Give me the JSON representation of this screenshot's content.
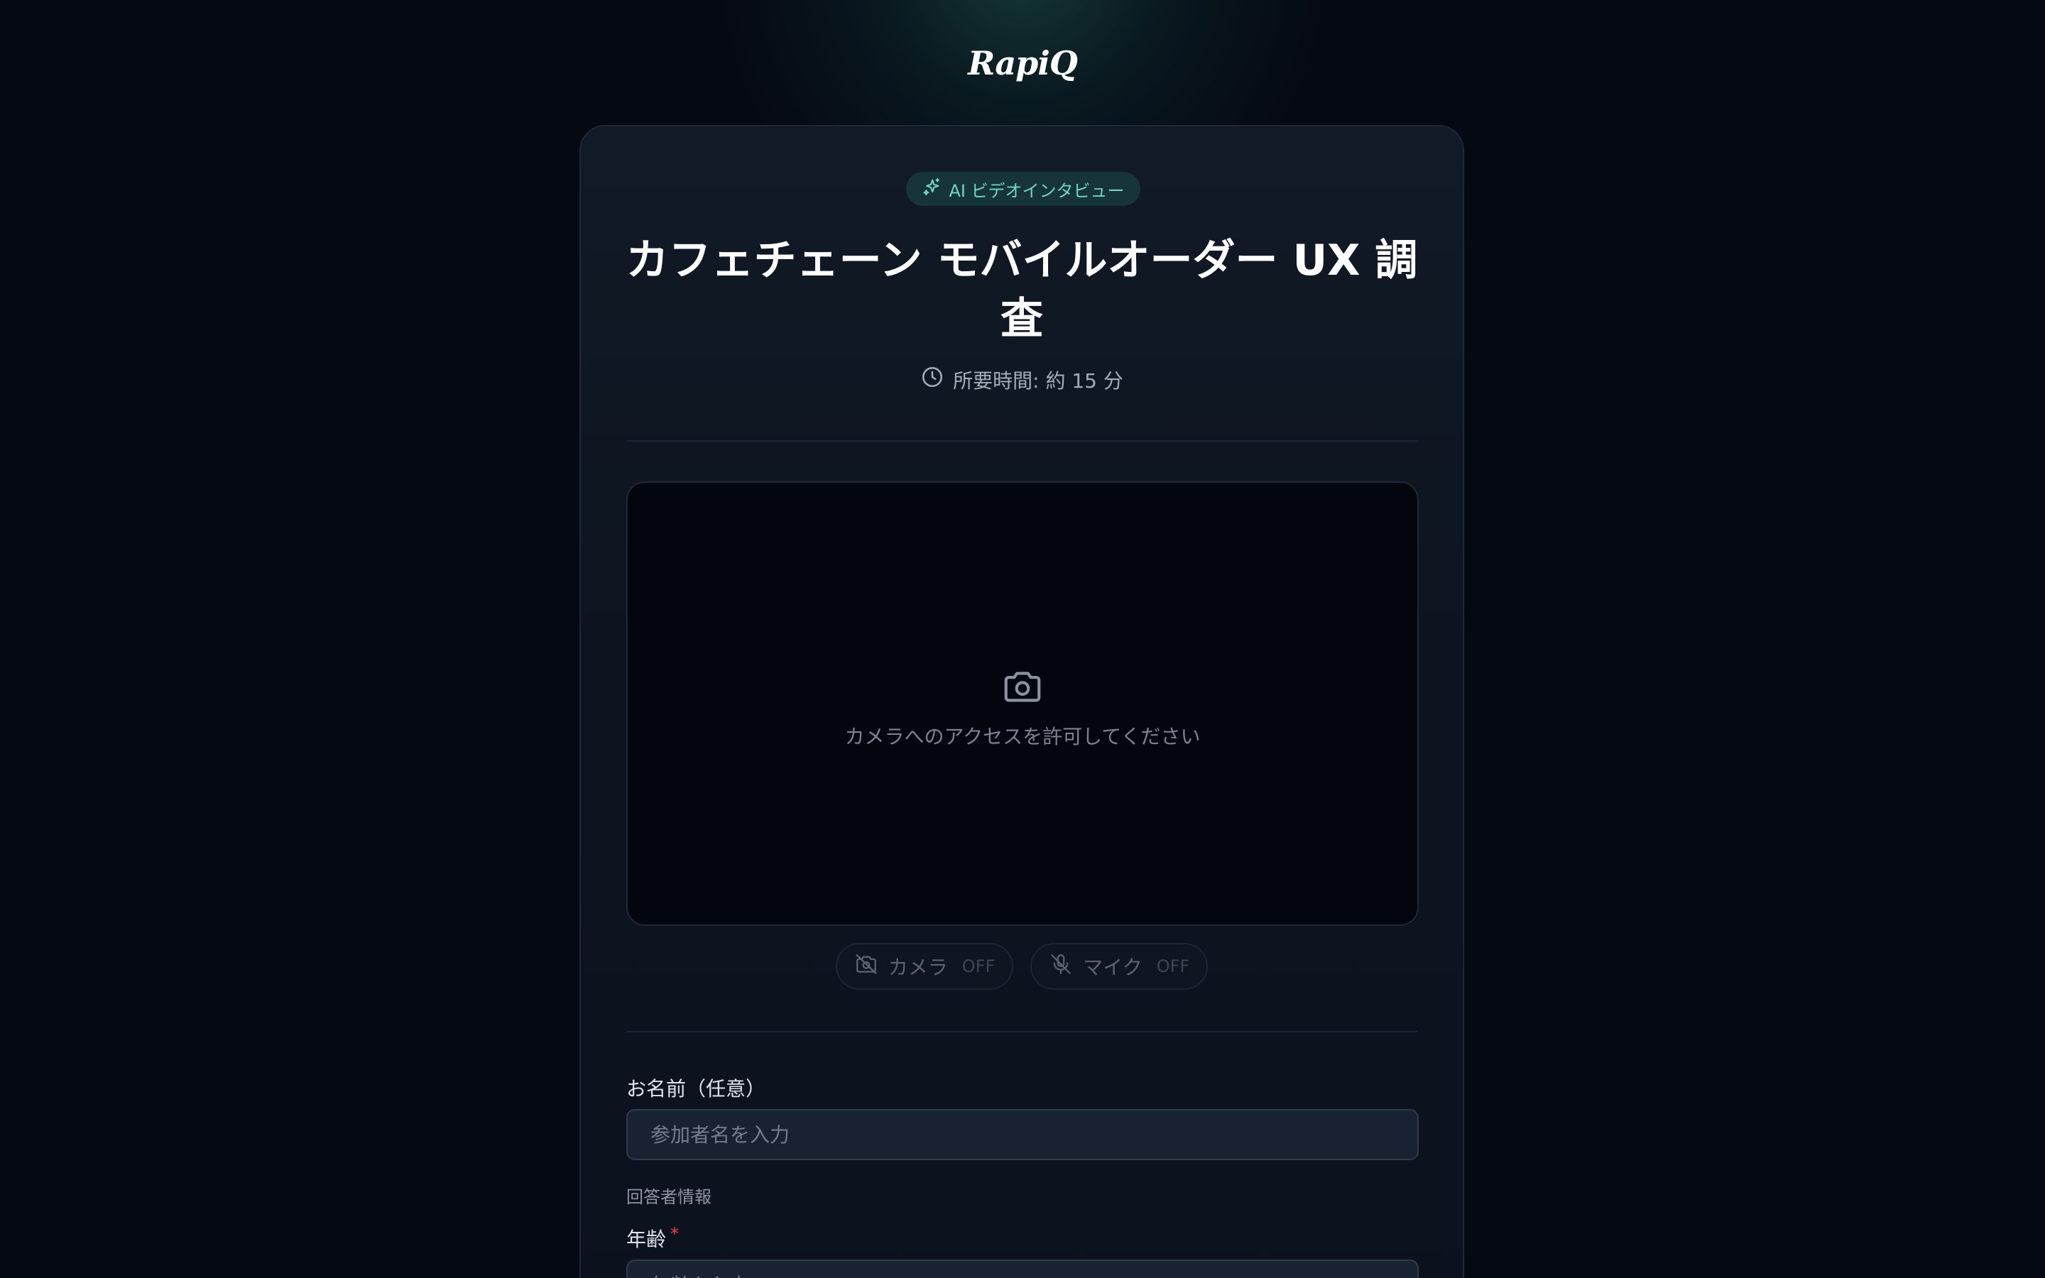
{
  "brand": {
    "logo_text": "RapiQ"
  },
  "badge": {
    "label": "AI ビデオインタビュー",
    "icon": "sparkles-icon",
    "color": "#6fd6bf"
  },
  "survey": {
    "title": "カフェチェーン モバイルオーダー UX 調査",
    "duration": "所要時間: 約 15 分"
  },
  "video": {
    "icon": "camera-icon",
    "message": "カメラへのアクセスを許可してください"
  },
  "controls": {
    "camera": {
      "label": "カメラ",
      "state": "OFF",
      "icon": "camera-off-icon"
    },
    "mic": {
      "label": "マイク",
      "state": "OFF",
      "icon": "mic-off-icon"
    }
  },
  "form": {
    "name": {
      "label": "お名前（任意）",
      "placeholder": "参加者名を入力"
    },
    "respondent_section": "回答者情報",
    "age": {
      "label": "年齢",
      "required_mark": "*",
      "placeholder": "年齢を入力"
    }
  },
  "colors": {
    "background": "#050913",
    "accent": "#6fd6bf",
    "required": "#ef4444"
  }
}
